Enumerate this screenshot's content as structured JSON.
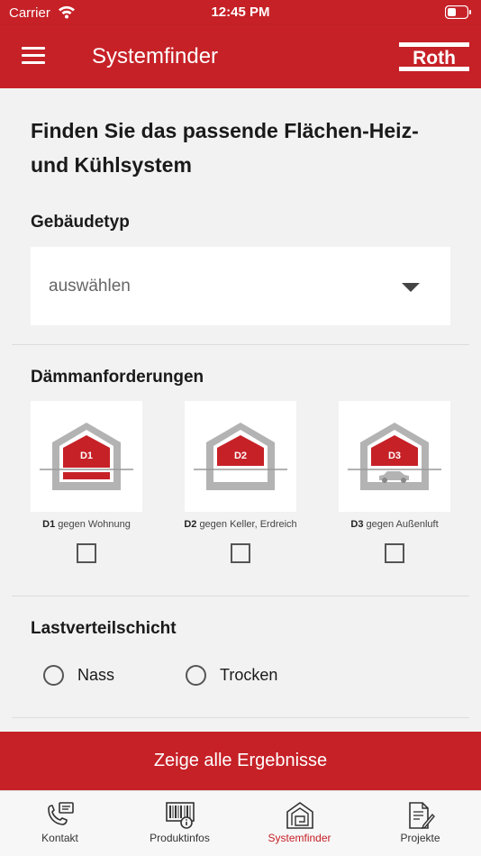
{
  "status_bar": {
    "carrier": "Carrier",
    "time": "12:45 PM"
  },
  "header": {
    "title": "Systemfinder",
    "logo_text": "Roth"
  },
  "main": {
    "heading": "Finden Sie das passende Flächen-Heiz- und Kühlsystem",
    "building_type": {
      "label": "Gebäudetyp",
      "placeholder": "auswählen"
    },
    "insulation": {
      "label": "Dämmanforderungen",
      "options": [
        {
          "code": "D1",
          "description": "gegen Wohnung",
          "checked": false
        },
        {
          "code": "D2",
          "description": "gegen Keller, Erdreich",
          "checked": false
        },
        {
          "code": "D3",
          "description": "gegen Außenluft",
          "checked": false
        }
      ]
    },
    "load_layer": {
      "label": "Lastverteilschicht",
      "options": [
        {
          "label": "Nass",
          "selected": false
        },
        {
          "label": "Trocken",
          "selected": false
        }
      ]
    }
  },
  "cta": {
    "label": "Zeige alle Ergebnisse"
  },
  "tabs": [
    {
      "label": "Kontakt",
      "icon": "contact-phone-icon",
      "active": false
    },
    {
      "label": "Produktinfos",
      "icon": "barcode-info-icon",
      "active": false
    },
    {
      "label": "Systemfinder",
      "icon": "house-maze-icon",
      "active": true
    },
    {
      "label": "Projekte",
      "icon": "document-edit-icon",
      "active": false
    }
  ],
  "colors": {
    "brand_red": "#c62127",
    "background": "#f2f2f2",
    "gray_icon": "#b3b3b3"
  }
}
